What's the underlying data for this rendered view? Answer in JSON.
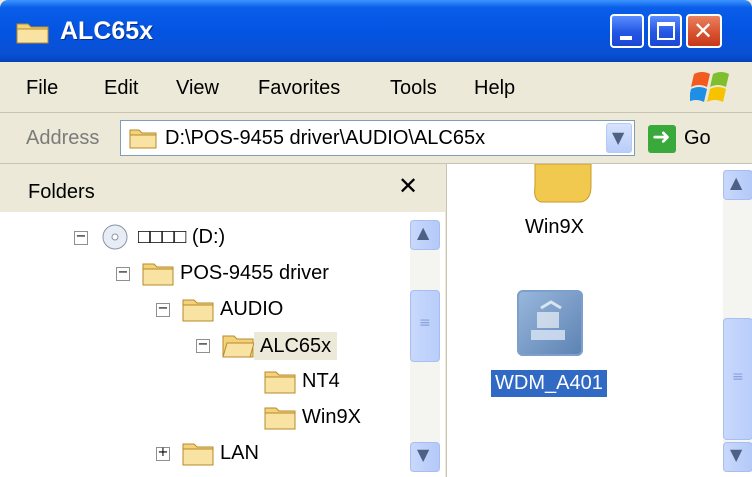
{
  "window": {
    "title": "ALC65x"
  },
  "title_buttons": {
    "close_glyph": "✕"
  },
  "menu": [
    "File",
    "Edit",
    "View",
    "Favorites",
    "Tools",
    "Help"
  ],
  "address": {
    "label": "Address",
    "value": "D:\\POS-9455 driver\\AUDIO\\ALC65x",
    "go_label": "Go"
  },
  "folders_pane": {
    "title": "Folders",
    "close_glyph": "✕",
    "tree": [
      {
        "label": "□□□□ (D:)",
        "toggle": "−",
        "icon": "cd-drive-icon"
      },
      {
        "label": "POS-9455 driver",
        "toggle": "−",
        "icon": "folder-icon"
      },
      {
        "label": "AUDIO",
        "toggle": "−",
        "icon": "folder-icon"
      },
      {
        "label": "ALC65x",
        "toggle": "−",
        "icon": "folder-open-icon",
        "selected": true
      },
      {
        "label": "NT4",
        "icon": "folder-icon"
      },
      {
        "label": "Win9X",
        "icon": "folder-icon"
      },
      {
        "label": "LAN",
        "toggle": "+",
        "icon": "folder-icon"
      }
    ]
  },
  "content_pane": {
    "items": [
      {
        "label": "Win9X",
        "icon": "folder-icon"
      },
      {
        "label": "WDM_A401",
        "icon": "driver-installer-icon",
        "selected": true
      }
    ]
  },
  "colors": {
    "titlebar": "#0354e2",
    "selection": "#316ac5",
    "close_button": "#d85330",
    "go_button": "#38a93a"
  }
}
